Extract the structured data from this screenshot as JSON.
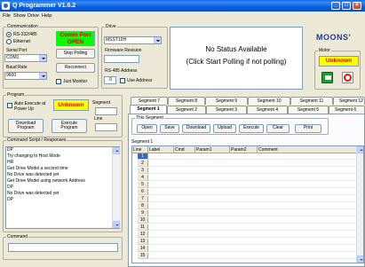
{
  "window": {
    "title": "Q Programmer V1.6.2"
  },
  "menu": [
    "File",
    "Show",
    "Drive",
    "Help"
  ],
  "communication": {
    "legend": "Communication",
    "rs232_label": "RS-232/485",
    "ethernet_label": "Ethernet",
    "serial_port_label": "Serial Port",
    "serial_port_value": "COM1",
    "baud_rate_label": "Baud Rate",
    "baud_rate_value": "9600",
    "comm_port_status": "Comm Port OPEN",
    "stop_polling": "Stop Polling",
    "reconnect": "Reconnect",
    "just_monitor": "Just Monitor"
  },
  "drive": {
    "legend": "Drive",
    "model_value": "MSST10H",
    "firmware_label": "Firmware Revision",
    "firmware_value": "",
    "rs485_label": "RS-485 Address",
    "rs485_value": "0",
    "use_address": "Use Address"
  },
  "status": {
    "line1": "No Status Available",
    "line2": "(Click Start Polling if not polling)"
  },
  "brand": {
    "logo_text": "MOONS'"
  },
  "motor": {
    "legend": "Motor",
    "status_value": "Unknown"
  },
  "program": {
    "legend": "Program",
    "auto_execute": "Auto Execute at Power Up",
    "status_value": "Unknown",
    "segment_label": "Segment",
    "line_label": "Line",
    "download_program": "Download Program",
    "execute_program": "Execute Program"
  },
  "script": {
    "legend": "Command Script / Responses",
    "lines": [
      "DP",
      "Try changing to Host Mode",
      "HR",
      "Get Drive Model a second time",
      "No Drive was detected yet",
      "Get Drive Model using network Address",
      "DP",
      "No Drive was detected yet",
      "DP"
    ]
  },
  "command": {
    "legend": "Command",
    "value": ""
  },
  "segment_tabs_back": [
    "Segment 7",
    "Segment 8",
    "Segment 9",
    "Segment 10",
    "Segment 11",
    "Segment 12"
  ],
  "segment_tabs_front": [
    "Segment 1",
    "Segment 2",
    "Segment 3",
    "Segment 4",
    "Segment 5",
    "Segment 6"
  ],
  "this_segment": {
    "legend": "This Segment",
    "buttons": [
      "Open",
      "Save",
      "Download",
      "Upload",
      "Execute",
      "Clear",
      "Print"
    ]
  },
  "segment_grid": {
    "caption": "Segment 1",
    "columns": [
      "Line",
      "Label",
      "Cmd",
      "Param1",
      "Param2",
      "Comment"
    ],
    "rows": [
      "1",
      "2",
      "3",
      "4",
      "5",
      "6",
      "7",
      "8",
      "9",
      "10",
      "11",
      "12",
      "13",
      "14",
      "15"
    ]
  }
}
